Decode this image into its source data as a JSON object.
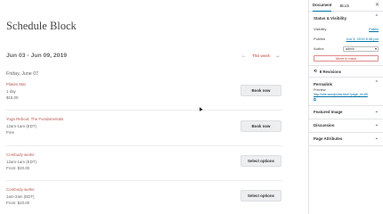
{
  "page": {
    "title": "Schedule Block",
    "week_range": "Jun 03 - Jun 09, 2019",
    "nav": {
      "prev_arrow": "←",
      "this_week": "This week",
      "next_arrow": "→"
    },
    "day_heading": "Friday, June 07",
    "events": [
      {
        "title": "Pilates Mat",
        "line2": "1 day",
        "line3": "$15.00",
        "button": "Book now"
      },
      {
        "title": "Yoga Reboot: The Fundamentals",
        "line2": "12am-1am (EDT)",
        "line3": "Free",
        "button": "Book now"
      },
      {
        "title": "Combody works",
        "line2": "12am-1am (EDT)",
        "line3": "From: $20.00",
        "button": "Select options"
      },
      {
        "title": "Combody works",
        "line2": "1am-2am (EDT)",
        "line3": "From: $20.00",
        "button": "Select options"
      }
    ]
  },
  "sidebar": {
    "tabs": [
      "Document",
      "Block"
    ],
    "close": "✕",
    "status": {
      "heading": "Status & Visibility",
      "visibility_label": "Visibility",
      "visibility_value": "Public",
      "publish_label": "Publish",
      "publish_value": "Jun 3, 2019 8:38 pm",
      "author_label": "Author",
      "author_value": "admin",
      "trash_label": "Move to trash"
    },
    "revisions": "8 Revisions",
    "permalink": {
      "heading": "Permalink",
      "preview_label": "Preview",
      "url": "http://site.wordpress.test/?page_id=65"
    },
    "sections": [
      "Featured Image",
      "Discussion",
      "Page Attributes"
    ]
  }
}
